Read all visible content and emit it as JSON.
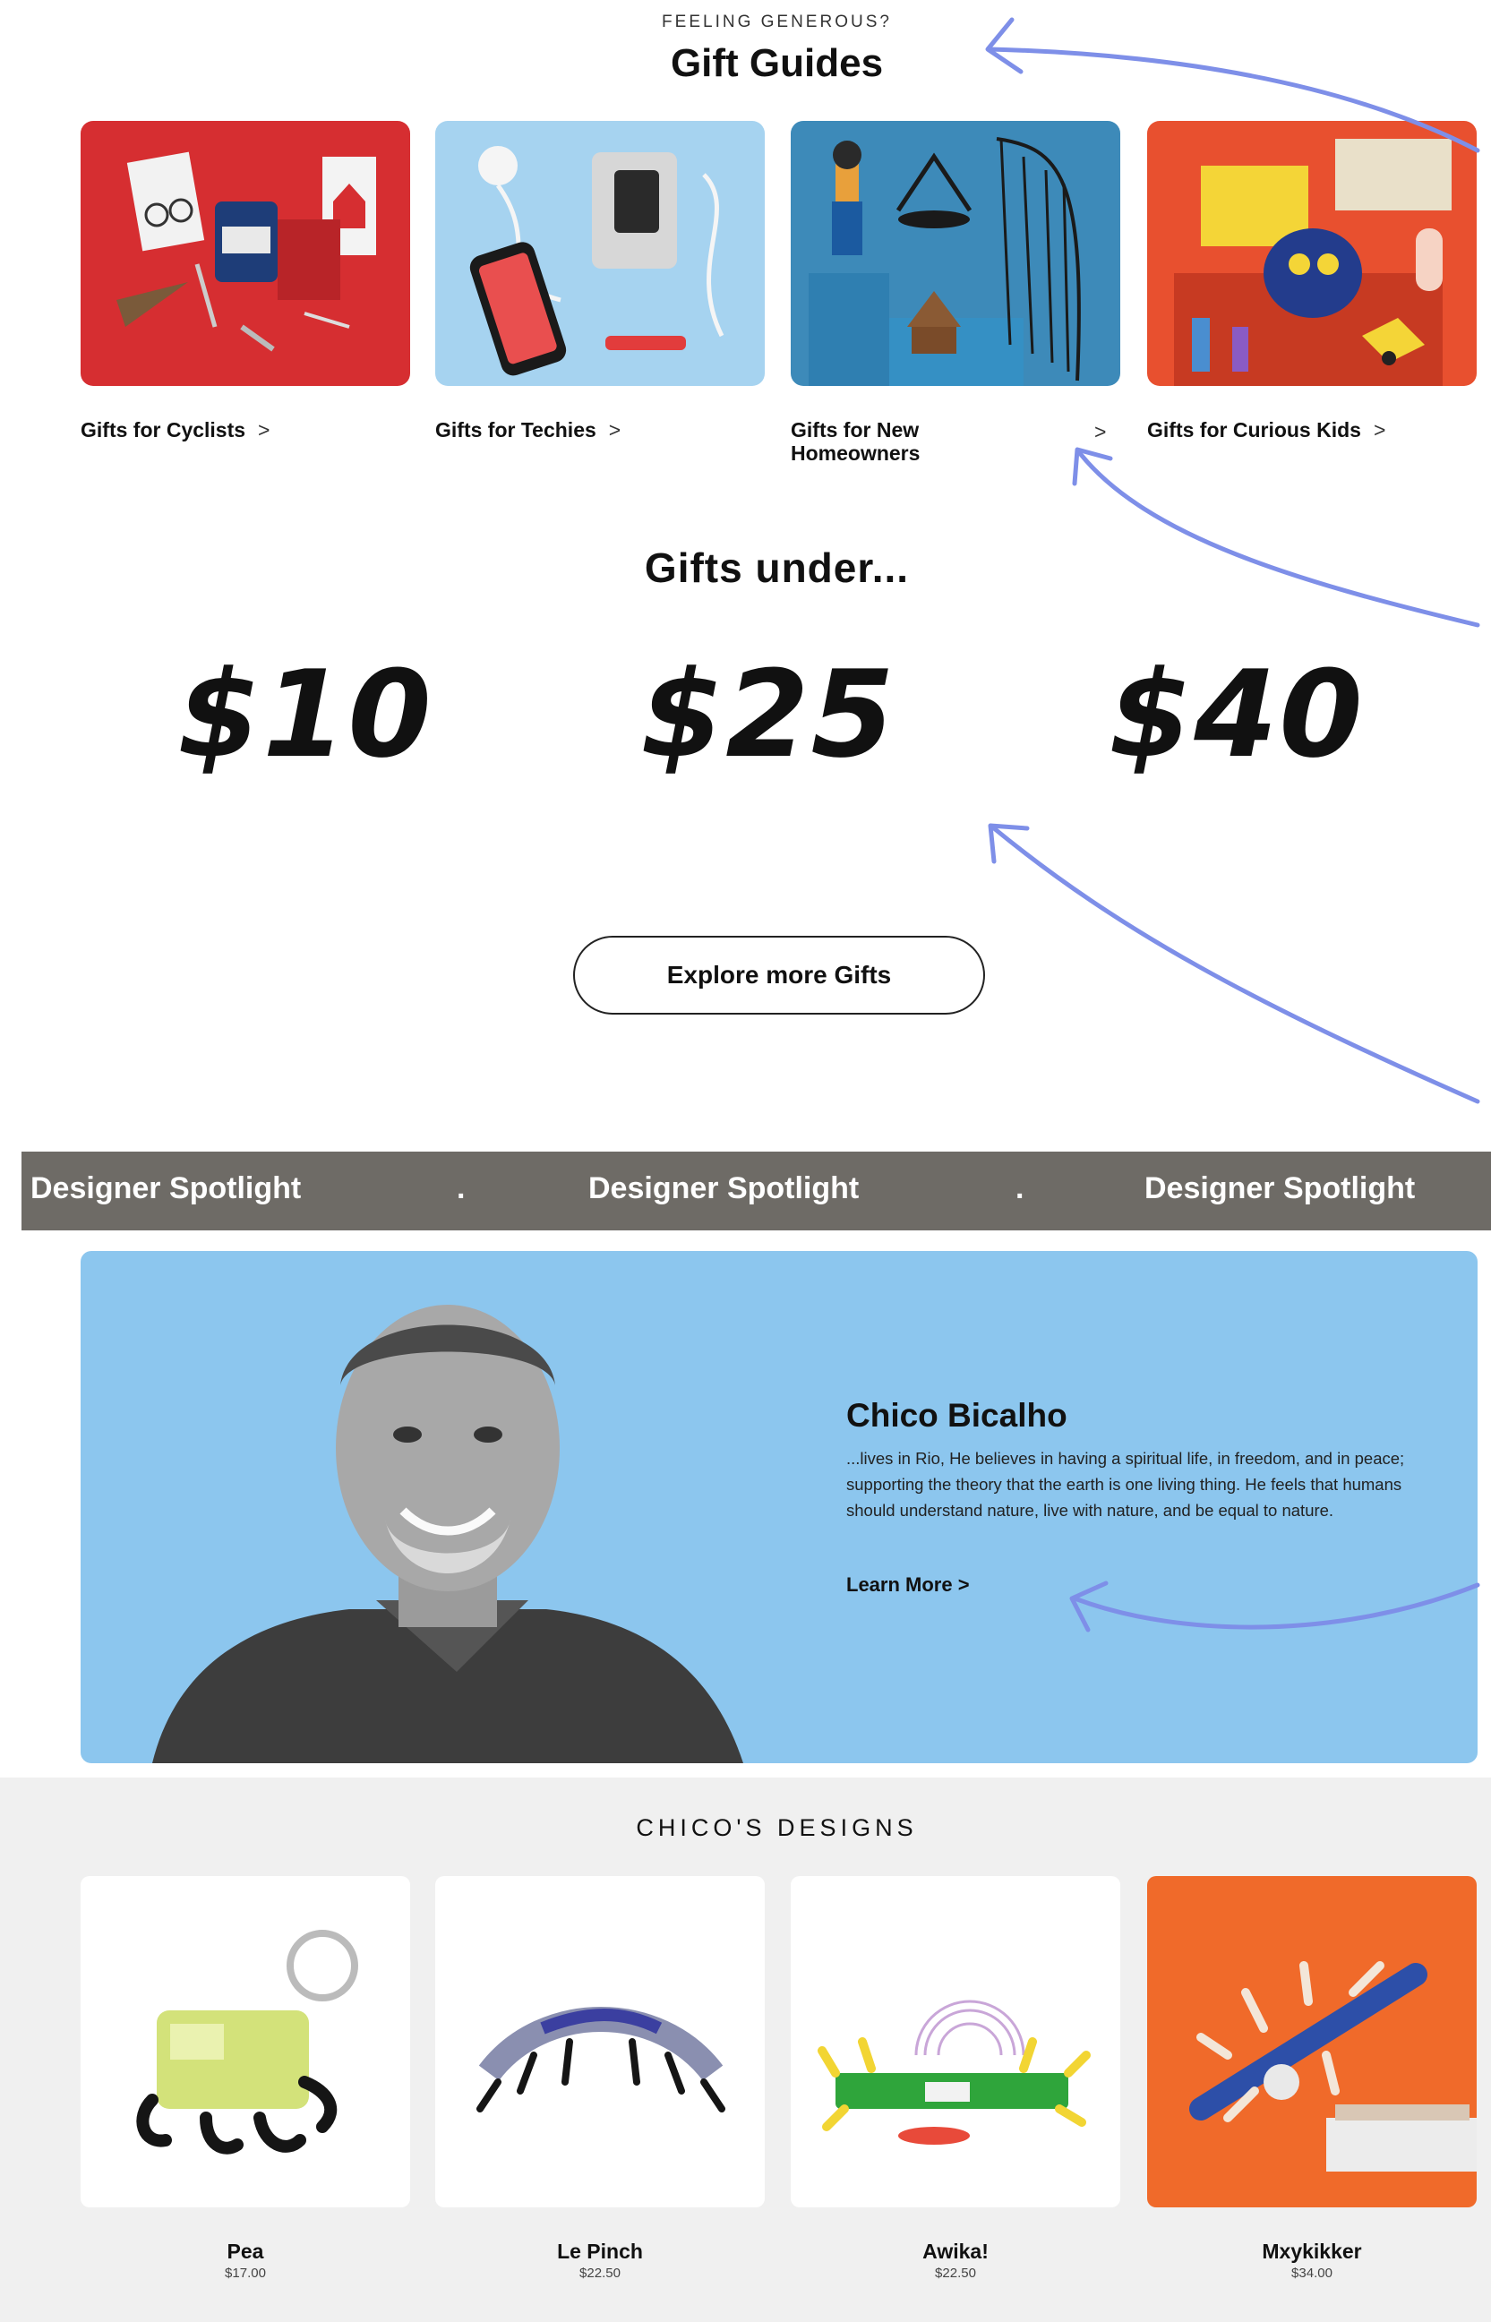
{
  "header": {
    "eyebrow": "FEELING GENEROUS?",
    "title": "Gift Guides"
  },
  "guides": [
    {
      "label": "Gifts for Cyclists",
      "chevron": ">"
    },
    {
      "label": "Gifts for Techies",
      "chevron": ">"
    },
    {
      "label": "Gifts for New Homeowners",
      "chevron": ">"
    },
    {
      "label": "Gifts for Curious Kids",
      "chevron": ">"
    }
  ],
  "gifts_under": {
    "title": "Gifts under...",
    "prices": [
      "$10",
      "$25",
      "$40"
    ]
  },
  "explore_button": "Explore more Gifts",
  "spotlight_band": {
    "label": "Designer Spotlight",
    "separator": "."
  },
  "designer": {
    "name": "Chico Bicalho",
    "bio": "...lives in Rio, He believes in having a spiritual life, in freedom, and in peace; supporting the theory that the earth is one living thing. He feels that humans should understand nature, live with nature, and be equal to nature.",
    "learn_more": "Learn More >"
  },
  "designs": {
    "title": "CHICO'S DESIGNS",
    "products": [
      {
        "name": "Pea",
        "price": "$17.00"
      },
      {
        "name": "Le Pinch",
        "price": "$22.50"
      },
      {
        "name": "Awika!",
        "price": "$22.50"
      },
      {
        "name": "Mxykikker",
        "price": "$34.00"
      }
    ]
  },
  "colors": {
    "accent_arrows": "#7e8fe8",
    "band": "#6e6b66",
    "designer_bg": "#8cc6ee",
    "designs_bg": "#f0f0f0"
  }
}
